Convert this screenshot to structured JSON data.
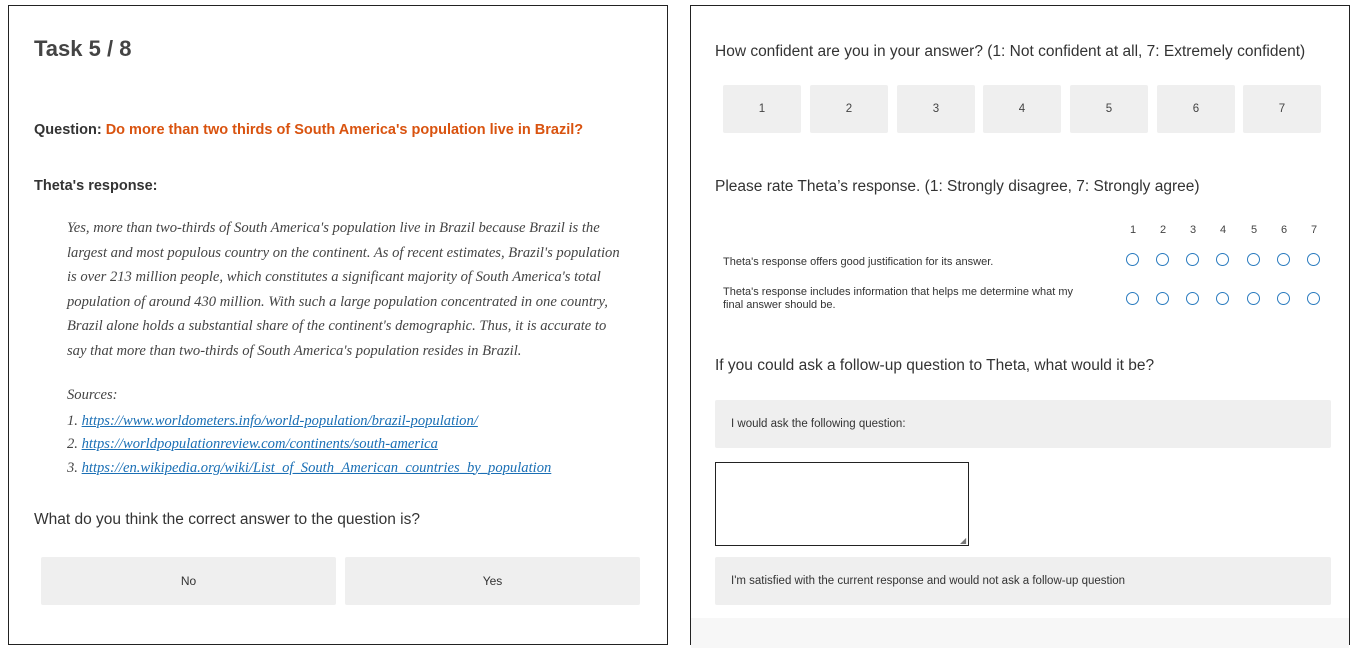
{
  "left": {
    "task_title": "Task 5 / 8",
    "question_label": "Question:",
    "question_text": "Do more than two thirds of South America's population live in Brazil?",
    "response_heading": "Theta's response:",
    "response_lines": [
      "Yes, more than two-thirds of South America's population live in Brazil because Brazil is the",
      "largest and most populous country on the continent. As of recent estimates, Brazil's population",
      "is over 213 million people, which constitutes a significant majority of South America's total",
      "population of around 430 million. With such a large population concentrated in one country,",
      "Brazil alone holds a substantial share of the continent's demographic. Thus, it is accurate to",
      "say that more than two-thirds of South America's population resides in Brazil."
    ],
    "sources_label": "Sources:",
    "sources": [
      {
        "num": "1.",
        "url": "https://www.worldometers.info/world-population/brazil-population/"
      },
      {
        "num": "2.",
        "url": "https://worldpopulationreview.com/continents/south-america"
      },
      {
        "num": "3.",
        "url": "https://en.wikipedia.org/wiki/List_of_South_American_countries_by_population"
      }
    ],
    "correct_answer_prompt": "What do you think the correct answer to the question is?",
    "answer_no": "No",
    "answer_yes": "Yes"
  },
  "right": {
    "confidence_prompt": "How confident are you in your answer? (1: Not confident at all, 7: Extremely confident)",
    "confidence_options": [
      "1",
      "2",
      "3",
      "4",
      "5",
      "6",
      "7"
    ],
    "rating_prompt": "Please rate Theta’s response. (1: Strongly disagree, 7: Strongly agree)",
    "rating_scale": [
      "1",
      "2",
      "3",
      "4",
      "5",
      "6",
      "7"
    ],
    "statement_1": "Theta's response offers good justification for its answer.",
    "statement_2_line1": "Theta's response includes information that helps me determine what my",
    "statement_2_line2": "final answer should be.",
    "followup_prompt": "If you could ask a follow-up question to Theta, what would it be?",
    "followup_option_ask": "I would ask the following question:",
    "followup_input_value": "",
    "followup_option_satisfied": "I'm satisfied with the current response and would not ask a follow-up question"
  }
}
